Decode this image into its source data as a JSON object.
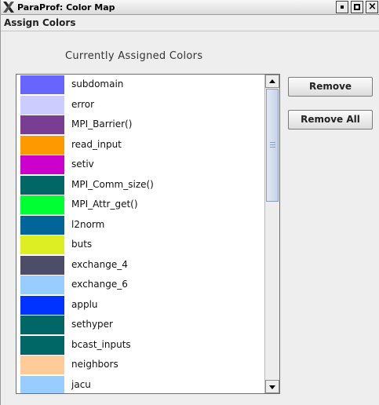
{
  "window": {
    "title": "ParaProf: Color Map",
    "controls": [
      "minimize",
      "maximize",
      "close"
    ]
  },
  "menubar": {
    "items": [
      "Assign Colors"
    ]
  },
  "panel": {
    "heading": "Currently Assigned Colors"
  },
  "color_list": [
    {
      "label": "subdomain",
      "color": "#6666ff"
    },
    {
      "label": "error",
      "color": "#ccccff"
    },
    {
      "label": "MPI_Barrier()",
      "color": "#7a3d94"
    },
    {
      "label": "read_input",
      "color": "#ff9900"
    },
    {
      "label": "setiv",
      "color": "#cc00cc"
    },
    {
      "label": "MPI_Comm_size()",
      "color": "#006666"
    },
    {
      "label": "MPI_Attr_get()",
      "color": "#00ff33"
    },
    {
      "label": "l2norm",
      "color": "#006699"
    },
    {
      "label": "buts",
      "color": "#ddee22"
    },
    {
      "label": "exchange_4",
      "color": "#4d4d6a"
    },
    {
      "label": "exchange_6",
      "color": "#99ccff"
    },
    {
      "label": "applu",
      "color": "#0033ff"
    },
    {
      "label": "sethyper",
      "color": "#006666"
    },
    {
      "label": "bcast_inputs",
      "color": "#006666"
    },
    {
      "label": "neighbors",
      "color": "#ffcc99"
    },
    {
      "label": "jacu",
      "color": "#99ccff"
    }
  ],
  "buttons": {
    "remove": "Remove",
    "remove_all": "Remove All"
  },
  "scrollbar": {
    "position": "top"
  }
}
